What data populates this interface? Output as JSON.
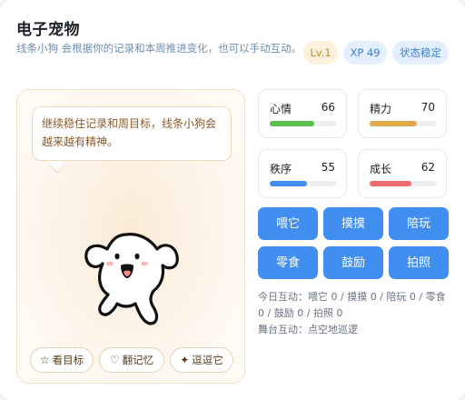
{
  "header": {
    "title": "电子宠物",
    "subtitle": "线条小狗 会根据你的记录和本周推进变化，也可以手动互动。",
    "badges": {
      "level": "Lv.1",
      "xp": "XP 49",
      "status": "状态稳定"
    },
    "colors": {
      "level_bg": "#fdf1dc",
      "level_fg": "#c38a2e",
      "xp_bg": "#e3effd",
      "xp_fg": "#3a7fd3"
    }
  },
  "stage": {
    "speech": "继续稳住记录和周目标，线条小狗会越来越有精神。",
    "pet_icon": "line-puppy-icon",
    "buttons": [
      {
        "icon": "☆",
        "icon_name": "star-icon",
        "label": "看目标"
      },
      {
        "icon": "♡",
        "icon_name": "heart-icon",
        "label": "翻记忆"
      },
      {
        "icon": "✦",
        "icon_name": "sparkle-icon",
        "label": "逗逗它"
      }
    ]
  },
  "stats": [
    {
      "label": "心情",
      "value": 66,
      "color": "#5bbf4f"
    },
    {
      "label": "精力",
      "value": 70,
      "color": "#e2aa4c"
    },
    {
      "label": "秩序",
      "value": 55,
      "color": "#3f8ef0"
    },
    {
      "label": "成长",
      "value": 62,
      "color": "#ee6b6b"
    }
  ],
  "actions": [
    "喂它",
    "摸摸",
    "陪玩",
    "零食",
    "鼓励",
    "拍照"
  ],
  "footer": {
    "today": "今日互动：喂它 0 / 摸摸 0 / 陪玩 0 / 零食 0 / 鼓励 0 / 拍照 0",
    "stage_line": "舞台互动：点空地巡逻"
  },
  "accent": "#3f8ef0"
}
